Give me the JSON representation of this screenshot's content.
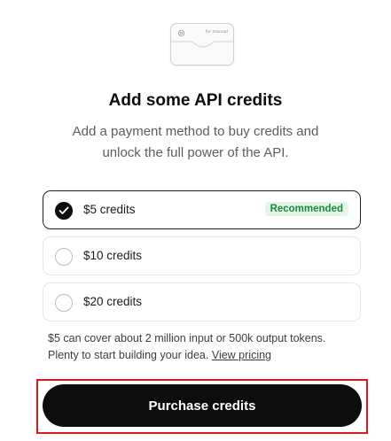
{
  "illustration": {
    "icon": "openai-logo-icon",
    "card_text": "for manual"
  },
  "header": {
    "title": "Add some API credits",
    "subtitle": "Add a payment method to buy credits and unlock the full power of the API."
  },
  "options": [
    {
      "label": "$5 credits",
      "selected": true,
      "badge": "Recommended"
    },
    {
      "label": "$10 credits",
      "selected": false
    },
    {
      "label": "$20 credits",
      "selected": false
    }
  ],
  "note": {
    "text": "$5 can cover about 2 million input or 500k output tokens. Plenty to start building your idea.",
    "link": "View pricing"
  },
  "actions": {
    "purchase_label": "Purchase credits"
  },
  "colors": {
    "accent": "#0d0d0d",
    "badge_bg": "#e3f6e8",
    "badge_text": "#1a8a3a",
    "highlight": "#e3141a"
  }
}
